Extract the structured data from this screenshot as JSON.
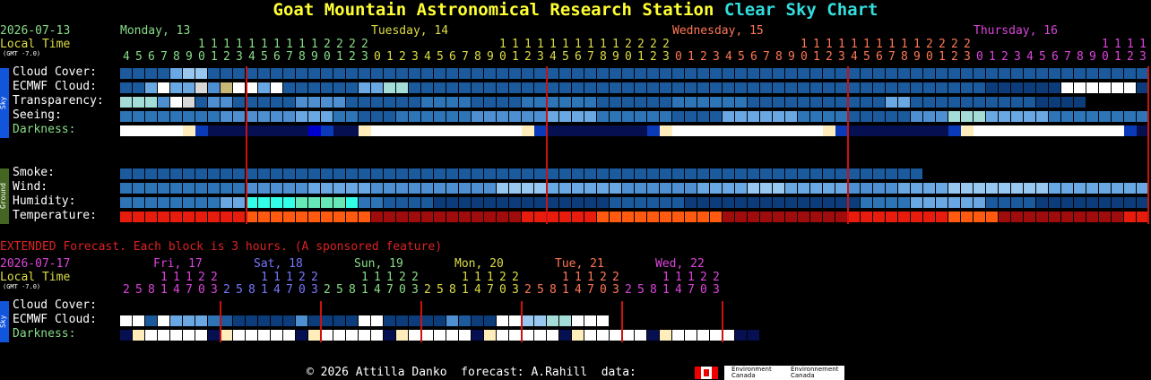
{
  "header": {
    "title_main": "Goat Mountain Astronomical Research Station",
    "title_sub": "Clear Sky Chart"
  },
  "left_header": {
    "date": "2026-07-13",
    "local_time": "Local Time",
    "gmt": "(GMT -7.0)"
  },
  "day_labels": [
    {
      "text": "Monday, 13",
      "color": "#88dd88"
    },
    {
      "text": "Tuesday, 14",
      "color": "#dddd44"
    },
    {
      "text": "Wednesday, 15",
      "color": "#ff7755"
    },
    {
      "text": "Thursday, 16",
      "color": "#dd44dd"
    }
  ],
  "sky_side_label": "Sky",
  "ground_side_label": "Ground",
  "rows": {
    "cloud": "Cloud Cover:",
    "ecmwf": "ECMWF Cloud:",
    "transparency": "Transparency:",
    "seeing": "Seeing:",
    "darkness": "Darkness:",
    "smoke": "Smoke:",
    "wind": "Wind:",
    "humidity": "Humidity:",
    "temperature": "Temperature:"
  },
  "extended": {
    "notice": "EXTENDED Forecast. Each block is 3 hours. (A sponsored feature)",
    "date": "2026-07-17",
    "local_time": "Local Time",
    "gmt": "(GMT -7.0)",
    "rows": {
      "cloud": "Cloud Cover:",
      "ecmwf": "ECMWF Cloud:",
      "darkness": "Darkness:"
    },
    "days": [
      {
        "text": "Fri, 17",
        "color": "#dd44dd"
      },
      {
        "text": "Sat, 18",
        "color": "#7777ff"
      },
      {
        "text": "Sun, 19",
        "color": "#88dd88"
      },
      {
        "text": "Mon, 20",
        "color": "#dddd44"
      },
      {
        "text": "Tue, 21",
        "color": "#ff7755"
      },
      {
        "text": "Wed, 22",
        "color": "#dd44dd"
      }
    ]
  },
  "footer": {
    "text": "© 2026 Attilla Danko  forecast: A.Rahill  data:",
    "logo_en": "Environment Canada",
    "logo_fr": "Environnement Canada"
  }
}
